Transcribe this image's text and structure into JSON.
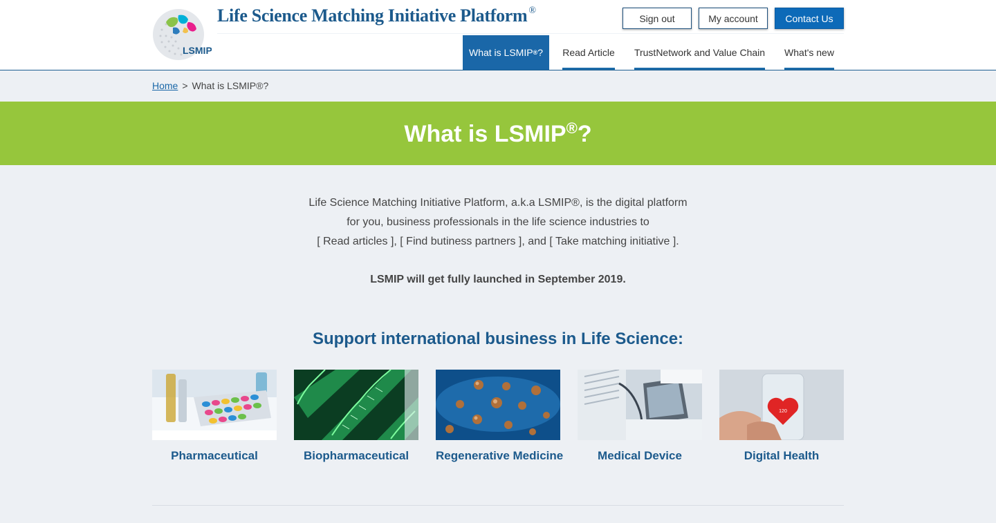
{
  "header": {
    "logo_text": "LSMIP",
    "site_title": "Life Science Matching Initiative Platform",
    "site_title_mark": "®",
    "buttons": {
      "sign_out": "Sign out",
      "my_account": "My account",
      "contact_us": "Contact Us"
    },
    "nav": [
      {
        "label": "What is LSMIP",
        "mark": "®",
        "suffix": "?",
        "active": true
      },
      {
        "label": "Read Article"
      },
      {
        "label": "TrustNetwork and Value Chain"
      },
      {
        "label": "What's new"
      }
    ]
  },
  "breadcrumb": {
    "home": "Home",
    "separator": ">",
    "current": "What is LSMIP®?"
  },
  "banner": {
    "title": "What is LSMIP",
    "mark": "®",
    "suffix": "?"
  },
  "intro": {
    "lines": [
      "Life Science Matching Initiative Platform, a.k.a LSMIP®, is the digital platform",
      "for you, business professionals in the life science industries to",
      "[ Read articles ], [ Find butiness partners ], and [ Take matching initiative ]."
    ],
    "launch": "LSMIP will get fully launched in September 2019."
  },
  "section_heading": "Support international business in Life Science:",
  "categories": [
    {
      "label": "Pharmaceutical"
    },
    {
      "label": "Biopharmaceutical"
    },
    {
      "label": "Regenerative Medicine"
    },
    {
      "label": "Medical Device"
    },
    {
      "label": "Digital Health",
      "image_text": "120"
    }
  ],
  "colors": {
    "brand_blue": "#1c5a8c",
    "nav_active": "#1a67a8",
    "banner_green": "#96c63c",
    "contact_button": "#0d6ab8"
  }
}
